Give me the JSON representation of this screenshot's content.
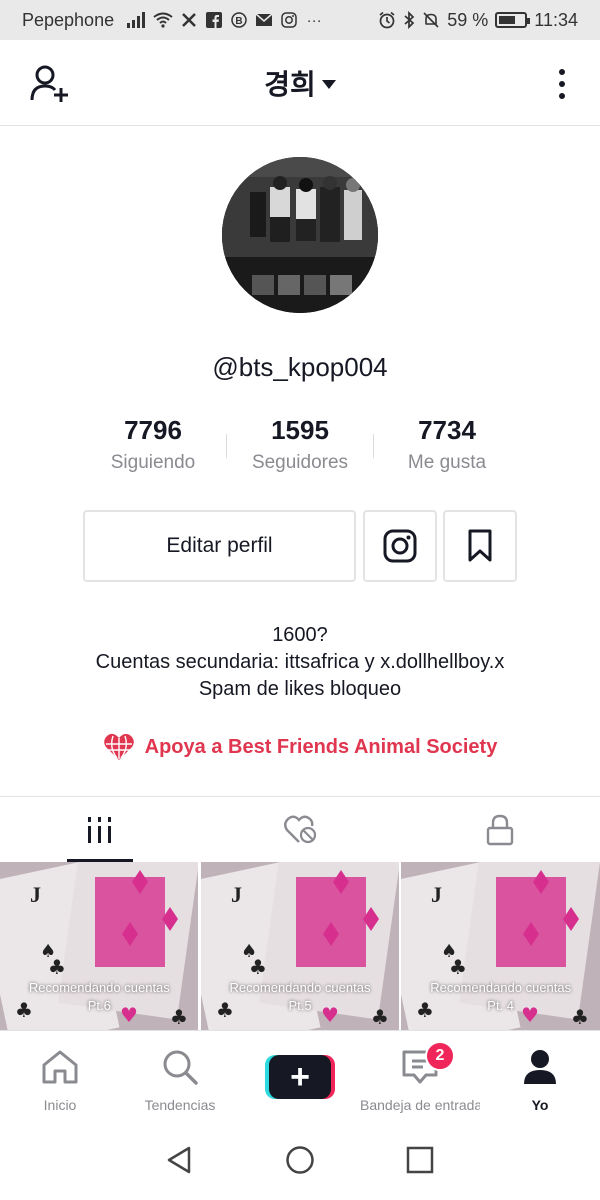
{
  "status_bar": {
    "carrier": "Pepephone",
    "battery": "59 %",
    "battery_level": 0.59,
    "time": "11:34"
  },
  "header": {
    "title": "경희"
  },
  "profile": {
    "username": "@bts_kpop004",
    "stats": [
      {
        "value": "7796",
        "label": "Siguiendo"
      },
      {
        "value": "1595",
        "label": "Seguidores"
      },
      {
        "value": "7734",
        "label": "Me gusta"
      }
    ],
    "edit_label": "Editar perfil",
    "bio": [
      "1600?",
      "Cuentas secundaria: ittsafrica y x.dollhellboy.x",
      "Spam de likes bloqueo"
    ],
    "charity": "Apoya a Best Friends Animal Society"
  },
  "videos": [
    {
      "line1": "Recomendando cuentas",
      "line2": "Pt.6"
    },
    {
      "line1": "Recomendando cuentas",
      "line2": "Pt.5"
    },
    {
      "line1": "Recomendando cuentas",
      "line2": "Pt. 4"
    }
  ],
  "bottom_nav": {
    "items": [
      {
        "label": "Inicio",
        "icon": "home-icon"
      },
      {
        "label": "Tendencias",
        "icon": "search-icon"
      },
      {
        "label": "",
        "icon": "plus-icon"
      },
      {
        "label": "Bandeja de entrada",
        "icon": "inbox-icon",
        "badge": "2"
      },
      {
        "label": "Yo",
        "icon": "profile-icon"
      }
    ]
  },
  "colors": {
    "accent": "#e0364f",
    "tiktok_cyan": "#2bd9de",
    "tiktok_pink": "#f0265a",
    "text": "#161823",
    "muted": "#8a8b91"
  }
}
